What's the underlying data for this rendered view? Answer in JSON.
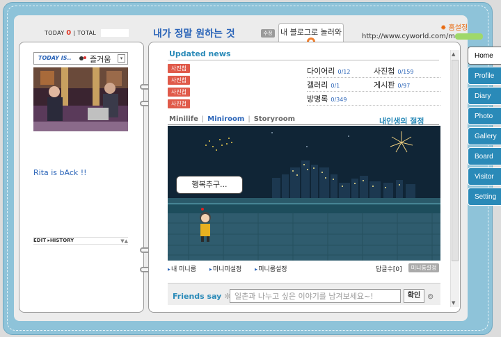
{
  "header": {
    "today_label": "TODAY",
    "today_count": "0",
    "divider": "|",
    "total_label": "TOTAL",
    "title": "내가 정말 원하는 것",
    "edit_badge": "수정",
    "blog_tab": "내 블로그로 놀러와",
    "home_setting": "홈설정",
    "url": "http://www.cyworld.com/m"
  },
  "profile": {
    "today_is_label": "TODAY IS..",
    "mood": "즐거움",
    "status_message": "Rita is bAck !!",
    "edit_history": "EDIT ▸HISTORY"
  },
  "updates": {
    "title": "Updated news",
    "tags": [
      "사진첩",
      "사진첩",
      "사진첩",
      "사진첩"
    ],
    "stats": [
      {
        "label": "다이어리",
        "count": "0/12"
      },
      {
        "label": "사진첩",
        "count": "0/159"
      },
      {
        "label": "갤러리",
        "count": "0/1"
      },
      {
        "label": "게시판",
        "count": "0/97"
      },
      {
        "label": "방명록",
        "count": "0/349"
      }
    ]
  },
  "room": {
    "tabs": [
      "Minilife",
      "Miniroom",
      "Storyroom"
    ],
    "active_tab": "Miniroom",
    "title": "내인생의 절정",
    "speech": "행복추구...",
    "links": [
      "내 미니룸",
      "미니미설정",
      "미니룸설정"
    ],
    "reply_count": "답글수[0]",
    "mini_setting": "미니룸설정"
  },
  "friends": {
    "label": "Friends say",
    "placeholder": "일촌과 나누고 싶은 이야기를 남겨보세요~!",
    "confirm": "확인"
  },
  "nav_tabs": [
    "Home",
    "Profile",
    "Diary",
    "Photo",
    "Gallery",
    "Board",
    "Visitor",
    "Setting"
  ],
  "colors": {
    "frame": "#8ec3d9",
    "tab_blue": "#2a8ab8",
    "news_tag": "#e05a4a",
    "title_blue": "#2a64b8"
  }
}
